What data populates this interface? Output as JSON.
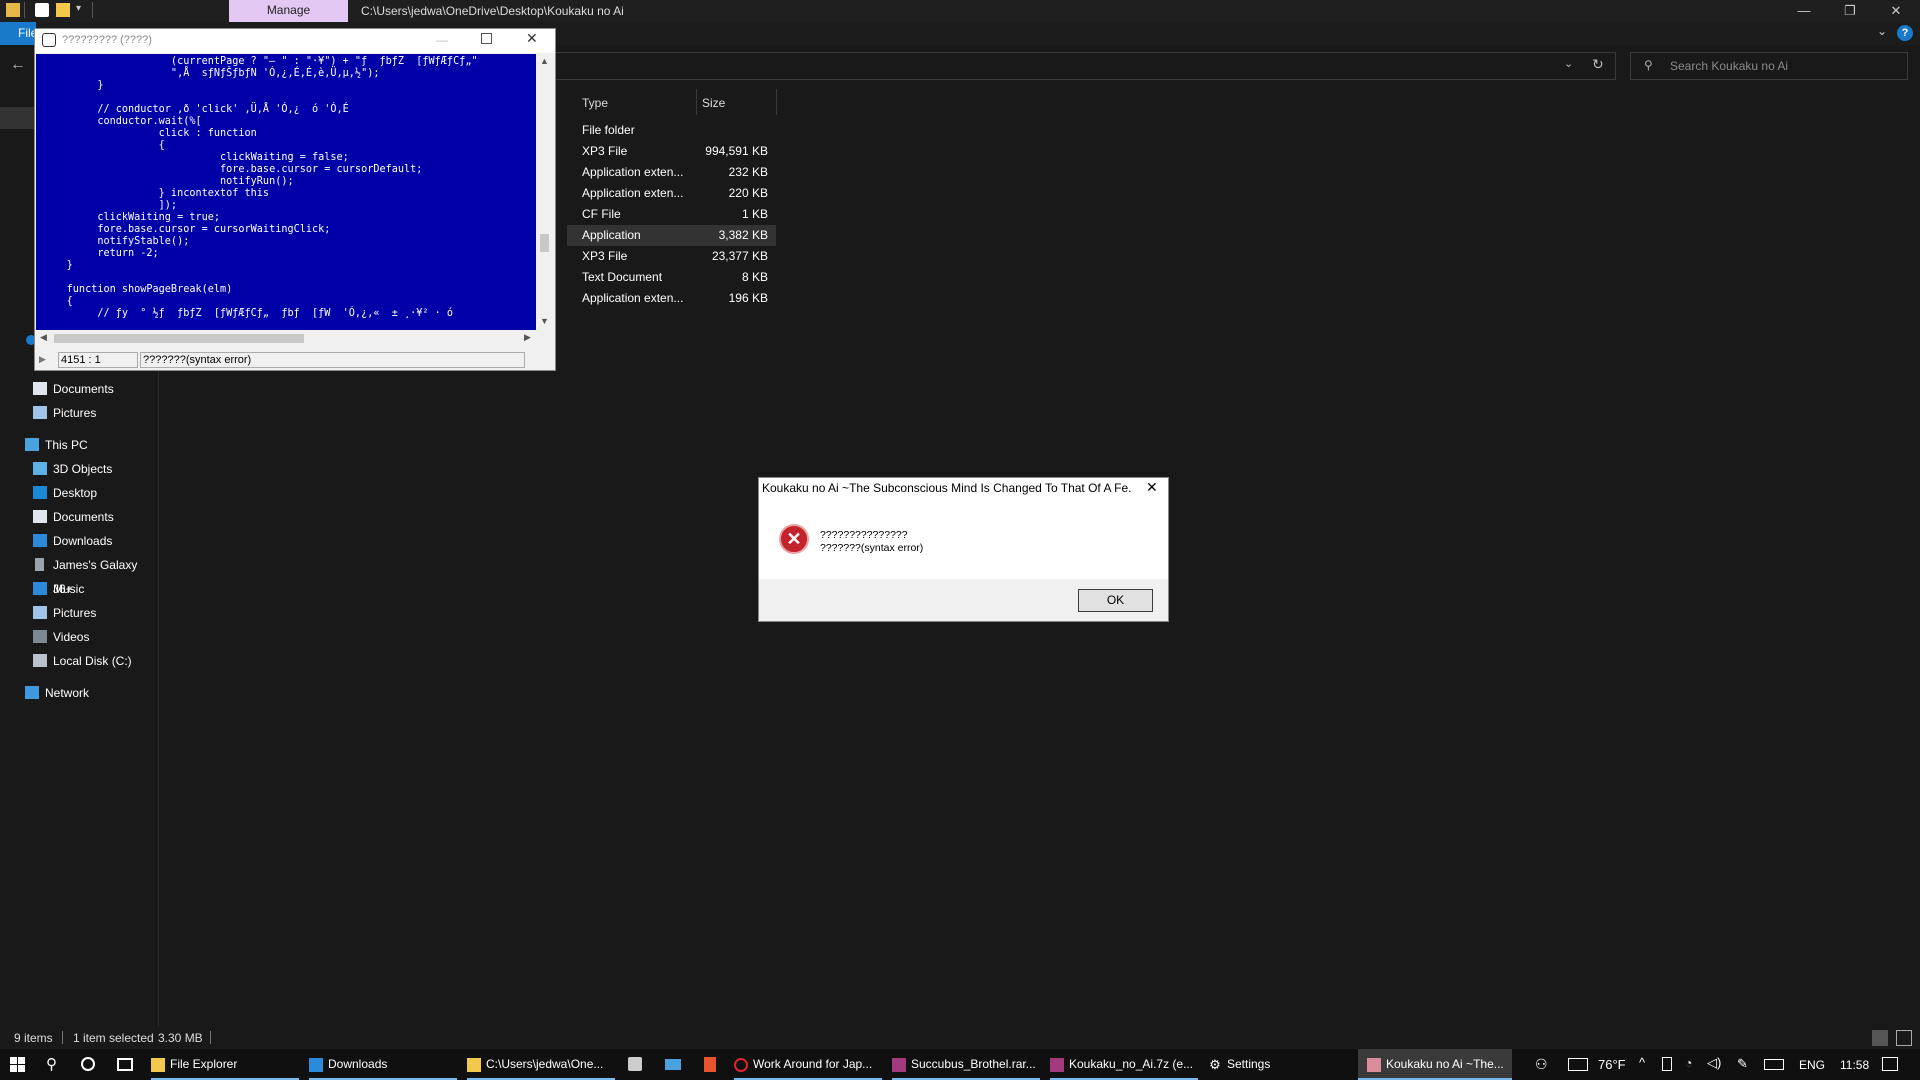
{
  "titlebar": {
    "manage_label": "Manage",
    "path": "C:\\Users\\jedwa\\OneDrive\\Desktop\\Koukaku no Ai",
    "minimize": "—",
    "restore": "❐",
    "close": "✕"
  },
  "ribbon": {
    "file_label": "File"
  },
  "search": {
    "placeholder": "Search Koukaku no Ai"
  },
  "navpane": {
    "items": [
      {
        "label": "Documents",
        "icon": "documents-icon"
      },
      {
        "label": "Pictures",
        "icon": "pictures-icon"
      },
      {
        "label": "This PC",
        "icon": "this-pc-icon"
      },
      {
        "label": "3D Objects",
        "icon": "3d-objects-icon"
      },
      {
        "label": "Desktop",
        "icon": "desktop-icon"
      },
      {
        "label": "Documents",
        "icon": "documents-icon"
      },
      {
        "label": "Downloads",
        "icon": "downloads-icon"
      },
      {
        "label": "James's Galaxy J6+",
        "icon": "phone-icon"
      },
      {
        "label": "Music",
        "icon": "music-icon"
      },
      {
        "label": "Pictures",
        "icon": "pictures-icon"
      },
      {
        "label": "Videos",
        "icon": "videos-icon"
      },
      {
        "label": "Local Disk (C:)",
        "icon": "disk-icon"
      },
      {
        "label": "Network",
        "icon": "network-icon"
      }
    ]
  },
  "filelist": {
    "columns": {
      "type": "Type",
      "size": "Size"
    },
    "rows": [
      {
        "type": "File folder",
        "size": ""
      },
      {
        "type": "XP3 File",
        "size": "994,591 KB"
      },
      {
        "type": "Application exten...",
        "size": "232 KB"
      },
      {
        "type": "Application exten...",
        "size": "220 KB"
      },
      {
        "type": "CF File",
        "size": "1 KB"
      },
      {
        "type": "Application",
        "size": "3,382 KB"
      },
      {
        "type": "XP3 File",
        "size": "23,377 KB"
      },
      {
        "type": "Text Document",
        "size": "8 KB"
      },
      {
        "type": "Application exten...",
        "size": "196 KB"
      }
    ],
    "selected_index": 5
  },
  "statusbar": {
    "items_count": "9 items",
    "selection": "1 item selected",
    "size": "3.30 MB"
  },
  "editor": {
    "title": "????????? (????)",
    "code": "                      (currentPage ? \"– \" : \"·¥\") + \"ƒ  ƒbƒZ  [ƒWƒÆƒCƒ„\"\n                      \",Å  sƒNƒŠƒbƒN 'Ó,¿,É,É,è,Ü,µ,½\");\n          }\n\n          // conductor ,ð 'click' ,Ü,Å 'Ó,¿  ó 'Ó,É\n          conductor.wait(%[\n                    click : function\n                    {\n                              clickWaiting = false;\n                              fore.base.cursor = cursorDefault;\n                              notifyRun();\n                    } incontextof this\n                    ]);\n          clickWaiting = true;\n          fore.base.cursor = cursorWaitingClick;\n          notifyStable();\n          return -2;\n     }\n\n     function showPageBreak(elm)\n     {\n          // ƒy  ° ½ƒ  ƒbƒZ  [ƒWƒÆƒCƒ„  ƒbƒ  [ƒW  'Ó,¿,«  ± ¸·¥² · ó",
    "position": "4151 : 1",
    "status_msg": "???????(syntax error)"
  },
  "dialog": {
    "title": "Koukaku no Ai  ~The Subconscious Mind Is Changed To That Of A Fe...",
    "message_line1": "???????????????",
    "message_line2": "???????(syntax error)",
    "ok_label": "OK"
  },
  "taskbar": {
    "items": [
      {
        "label": "File Explorer",
        "icon": "folder-icon"
      },
      {
        "label": "Downloads",
        "icon": "download-icon"
      },
      {
        "label": "C:\\Users\\jedwa\\One...",
        "icon": "folder-icon"
      },
      {
        "label": "Work Around for Jap...",
        "icon": "opera-icon"
      },
      {
        "label": "Succubus_Brothel.rar...",
        "icon": "winrar-icon"
      },
      {
        "label": "Koukaku_no_Ai.7z (e...",
        "icon": "winrar-icon"
      },
      {
        "label": "Settings",
        "icon": "settings-icon"
      },
      {
        "label": "Koukaku no Ai  ~The...",
        "icon": "game-icon"
      }
    ],
    "tray": {
      "temperature": "76°F",
      "language": "ENG",
      "time": "11:58"
    }
  },
  "colors": {
    "accent": "#1979ca",
    "manage_tab": "#e3c8f3",
    "editor_bg": "#0000a8",
    "error_red": "#c3242b"
  }
}
